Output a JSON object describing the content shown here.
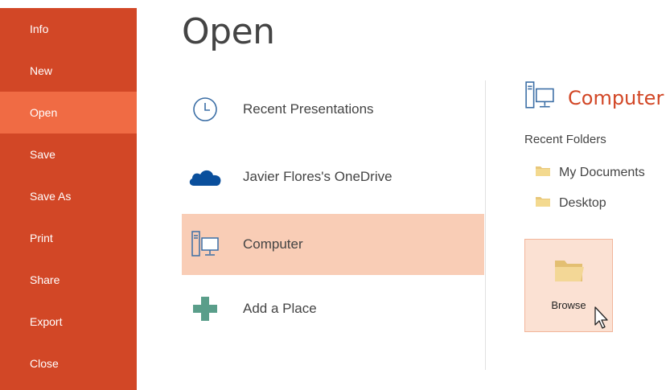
{
  "sidebar": {
    "items": [
      {
        "label": "Info"
      },
      {
        "label": "New"
      },
      {
        "label": "Open",
        "active": true
      },
      {
        "label": "Save"
      },
      {
        "label": "Save As"
      },
      {
        "label": "Print"
      },
      {
        "label": "Share"
      },
      {
        "label": "Export"
      },
      {
        "label": "Close"
      }
    ],
    "bg_color": "#d24726",
    "active_color": "#f06b44"
  },
  "main": {
    "title": "Open",
    "places": [
      {
        "label": "Recent Presentations",
        "icon": "clock-icon"
      },
      {
        "label": "Javier Flores's OneDrive",
        "icon": "onedrive-cloud-icon"
      },
      {
        "label": "Computer",
        "icon": "computer-icon",
        "selected": true
      },
      {
        "label": "Add a Place",
        "icon": "plus-icon"
      }
    ],
    "selected_color": "#f9cdb6"
  },
  "right_pane": {
    "title": "Computer",
    "title_icon": "computer-icon",
    "accent_color": "#d24726",
    "recent_folders_label": "Recent Folders",
    "folders": [
      {
        "label": "My Documents",
        "icon": "folder-icon"
      },
      {
        "label": "Desktop",
        "icon": "folder-icon"
      }
    ],
    "browse": {
      "label": "Browse",
      "icon": "folder-open-icon"
    }
  }
}
